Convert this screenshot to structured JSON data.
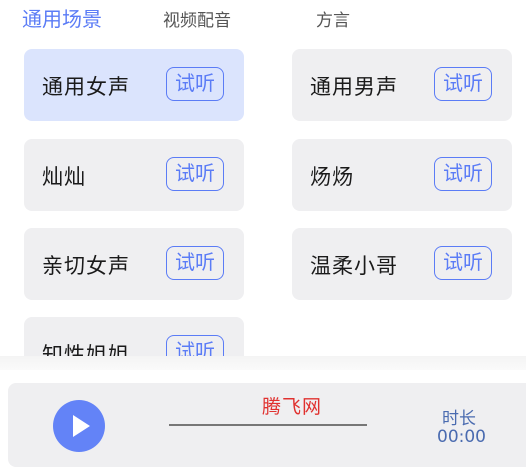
{
  "tabs": [
    {
      "label": "通用场景",
      "active": true
    },
    {
      "label": "视频配音",
      "active": false
    },
    {
      "label": "方言",
      "active": false
    }
  ],
  "voices": [
    {
      "name": "通用女声",
      "listen": "试听",
      "selected": true
    },
    {
      "name": "通用男声",
      "listen": "试听",
      "selected": false
    },
    {
      "name": "灿灿",
      "listen": "试听",
      "selected": false
    },
    {
      "name": "炀炀",
      "listen": "试听",
      "selected": false
    },
    {
      "name": "亲切女声",
      "listen": "试听",
      "selected": false
    },
    {
      "name": "温柔小哥",
      "listen": "试听",
      "selected": false
    },
    {
      "name": "知性姐姐",
      "listen": "试听",
      "selected": false
    }
  ],
  "player": {
    "watermark": "腾飞网",
    "duration_label": "时长",
    "duration_value": "00:00",
    "play_icon": "play-icon"
  },
  "colors": {
    "accent": "#5b7cf6",
    "selected_card": "#dbe4fd",
    "card": "#efeff1",
    "watermark": "#e0312f"
  }
}
